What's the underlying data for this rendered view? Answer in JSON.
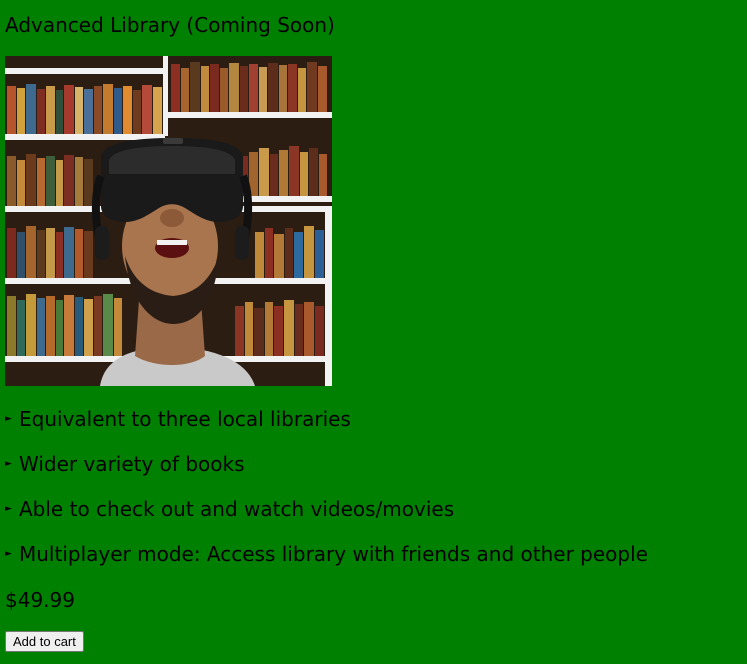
{
  "product": {
    "title": "Advanced Library (Coming Soon)",
    "image_description": "man-wearing-vr-headset-in-front-of-bookshelves",
    "features": [
      "Equivalent to three local libraries",
      "Wider variety of books",
      "Able to check out and watch videos/movies",
      "Multiplayer mode: Access library with friends and other people"
    ],
    "bullet_icon": "triangle-right-icon",
    "price": "$49.99",
    "add_to_cart_label": "Add to cart"
  },
  "colors": {
    "page_background": "#008000",
    "text": "#000000",
    "button_background": "#efefef"
  }
}
